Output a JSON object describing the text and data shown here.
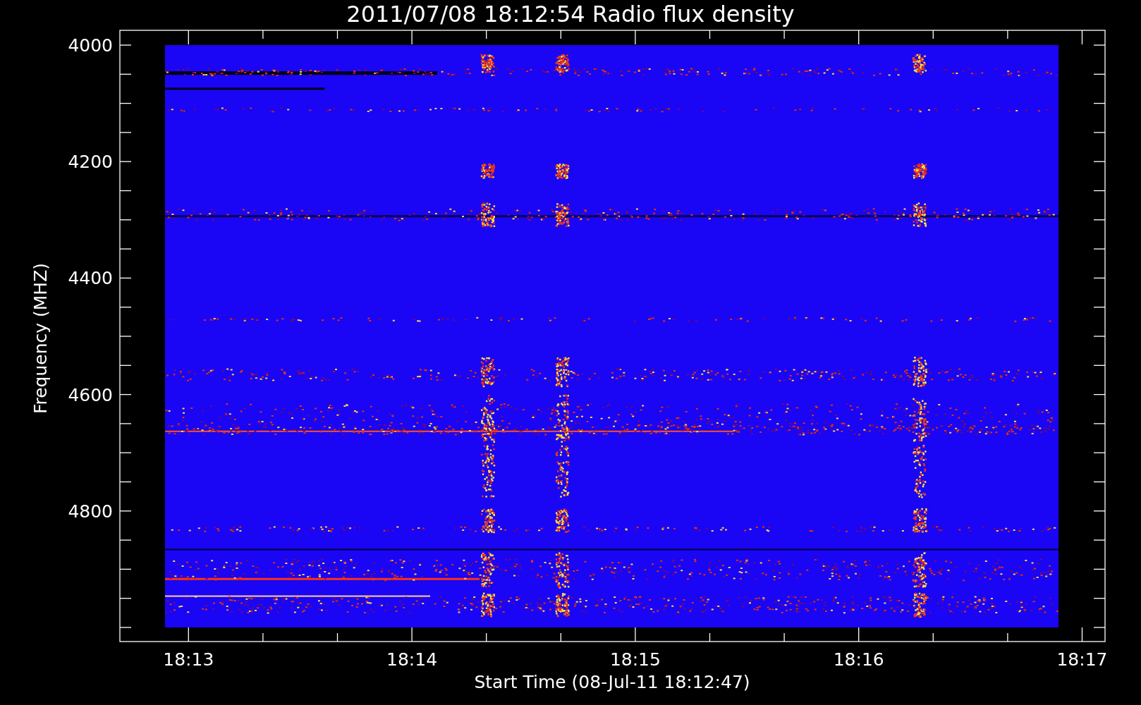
{
  "title": "2011/07/08 18:12:54 Radio flux density",
  "y_axis": {
    "label": "Frequency (MHZ)",
    "ticks": [
      "4000",
      "4200",
      "4400",
      "4600",
      "4800"
    ]
  },
  "x_axis": {
    "label": "Start Time (08-Jul-11 18:12:47)",
    "ticks": [
      "18:13",
      "18:14",
      "18:15",
      "18:16",
      "18:17"
    ]
  }
}
